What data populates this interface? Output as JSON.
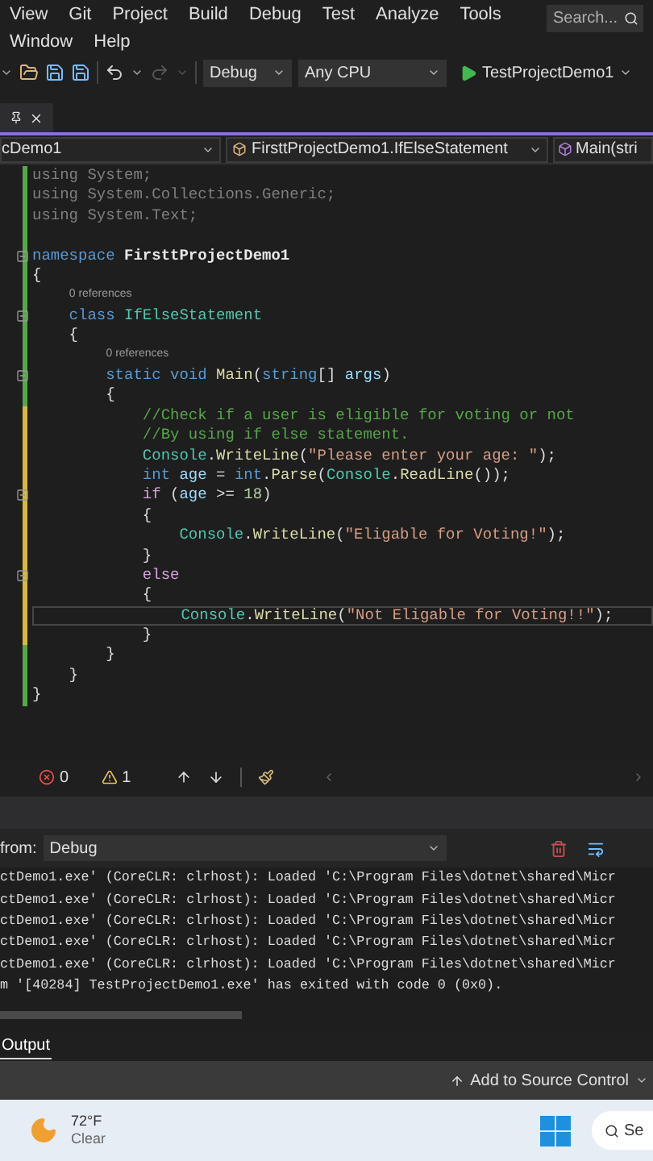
{
  "menu_rows": [
    [
      "View",
      "Git",
      "Project",
      "Build",
      "Debug",
      "Test",
      "Analyze",
      "Tools"
    ],
    [
      "Window",
      "Help"
    ]
  ],
  "search": {
    "placeholder": "Search..."
  },
  "toolbar": {
    "undo": {
      "disabled": false
    },
    "redo": {
      "disabled": true
    },
    "configuration": "Debug",
    "platform": "Any CPU",
    "start_target": "TestProjectDemo1"
  },
  "nav_bar": {
    "project": "cDemo1",
    "type": "FirsttProjectDemo1.IfElseStatement",
    "member": "Main(stri"
  },
  "editor": {
    "lines": [
      {
        "modified": false,
        "fold": false,
        "current": false,
        "tokens": [
          {
            "kind": "dim",
            "text": "using System;"
          }
        ]
      },
      {
        "modified": false,
        "fold": false,
        "current": false,
        "tokens": [
          {
            "kind": "dim",
            "text": "using System.Collections.Generic;"
          }
        ]
      },
      {
        "modified": false,
        "fold": false,
        "current": false,
        "tokens": [
          {
            "kind": "dim",
            "text": "using System.Text;"
          }
        ]
      },
      {
        "modified": false,
        "fold": false,
        "current": false
      },
      {
        "modified": false,
        "fold": true,
        "current": false,
        "tokens": [
          {
            "kind": "keyword",
            "text": "namespace"
          },
          {
            "kind": "name",
            "text": " FirsttProjectDemo1"
          }
        ]
      },
      {
        "modified": false,
        "fold": false,
        "current": false,
        "tokens": [
          {
            "kind": "plain",
            "text": "{"
          }
        ]
      },
      {
        "modified": false,
        "fold": true,
        "current": false,
        "reference_count": "0 references",
        "tokens": [
          {
            "kind": "keyword",
            "text": "    class"
          },
          {
            "kind": "type",
            "text": " IfElseStatement"
          }
        ]
      },
      {
        "modified": false,
        "fold": false,
        "current": false,
        "tokens": [
          {
            "kind": "plain",
            "text": "    {"
          }
        ]
      },
      {
        "modified": false,
        "fold": true,
        "current": false,
        "reference_count": "0 references",
        "tokens": [
          {
            "kind": "keyword",
            "text": "        static void"
          },
          {
            "kind": "method",
            "text": " Main"
          },
          {
            "kind": "plain",
            "text": "("
          },
          {
            "kind": "keyword",
            "text": "string"
          },
          {
            "kind": "plain",
            "text": "[] "
          },
          {
            "kind": "param",
            "text": "args"
          },
          {
            "kind": "plain",
            "text": ")"
          }
        ]
      },
      {
        "modified": false,
        "fold": false,
        "current": false,
        "tokens": [
          {
            "kind": "plain",
            "text": "        {"
          }
        ]
      },
      {
        "modified": true,
        "fold": false,
        "current": false,
        "tokens": [
          {
            "kind": "comment",
            "text": "            //Check if a user is eligible for voting or not"
          }
        ]
      },
      {
        "modified": true,
        "fold": false,
        "current": false,
        "tokens": [
          {
            "kind": "comment",
            "text": "            //By using if else statement."
          }
        ]
      },
      {
        "modified": true,
        "fold": false,
        "current": false,
        "tokens": [
          {
            "kind": "type",
            "text": "            Console"
          },
          {
            "kind": "plain",
            "text": "."
          },
          {
            "kind": "method",
            "text": "WriteLine"
          },
          {
            "kind": "plain",
            "text": "("
          },
          {
            "kind": "string",
            "text": "\"Please enter your age: \""
          },
          {
            "kind": "plain",
            "text": ");"
          }
        ]
      },
      {
        "modified": true,
        "fold": false,
        "current": false,
        "tokens": [
          {
            "kind": "keyword",
            "text": "            int"
          },
          {
            "kind": "param",
            "text": " age"
          },
          {
            "kind": "plain",
            "text": " = "
          },
          {
            "kind": "keyword",
            "text": "int"
          },
          {
            "kind": "plain",
            "text": "."
          },
          {
            "kind": "method",
            "text": "Parse"
          },
          {
            "kind": "plain",
            "text": "("
          },
          {
            "kind": "type",
            "text": "Console"
          },
          {
            "kind": "plain",
            "text": "."
          },
          {
            "kind": "method",
            "text": "ReadLine"
          },
          {
            "kind": "plain",
            "text": "());"
          }
        ]
      },
      {
        "modified": true,
        "fold": true,
        "current": false,
        "tokens": [
          {
            "kind": "control",
            "text": "            if"
          },
          {
            "kind": "plain",
            "text": " ("
          },
          {
            "kind": "param",
            "text": "age"
          },
          {
            "kind": "plain",
            "text": " >= "
          },
          {
            "kind": "number",
            "text": "18"
          },
          {
            "kind": "plain",
            "text": ")"
          }
        ]
      },
      {
        "modified": true,
        "fold": false,
        "current": false,
        "tokens": [
          {
            "kind": "plain",
            "text": "            {"
          }
        ]
      },
      {
        "modified": true,
        "fold": false,
        "current": false,
        "tokens": [
          {
            "kind": "type",
            "text": "                Console"
          },
          {
            "kind": "plain",
            "text": "."
          },
          {
            "kind": "method",
            "text": "WriteLine"
          },
          {
            "kind": "plain",
            "text": "("
          },
          {
            "kind": "string",
            "text": "\"Eligable for Voting!\""
          },
          {
            "kind": "plain",
            "text": ");"
          }
        ]
      },
      {
        "modified": true,
        "fold": false,
        "current": false,
        "tokens": [
          {
            "kind": "plain",
            "text": "            }"
          }
        ]
      },
      {
        "modified": true,
        "fold": true,
        "current": false,
        "tokens": [
          {
            "kind": "control",
            "text": "            else"
          }
        ]
      },
      {
        "modified": true,
        "fold": false,
        "current": false,
        "tokens": [
          {
            "kind": "plain",
            "text": "            {"
          }
        ]
      },
      {
        "modified": true,
        "fold": false,
        "current": true,
        "tokens": [
          {
            "kind": "type",
            "text": "                Console"
          },
          {
            "kind": "plain",
            "text": "."
          },
          {
            "kind": "method",
            "text": "WriteLine"
          },
          {
            "kind": "plain",
            "text": "("
          },
          {
            "kind": "string",
            "text": "\"Not Eligable for Voting!!\""
          },
          {
            "kind": "plain",
            "text": ");"
          }
        ]
      },
      {
        "modified": true,
        "fold": false,
        "current": false,
        "tokens": [
          {
            "kind": "plain",
            "text": "            }"
          }
        ]
      },
      {
        "modified": false,
        "fold": false,
        "current": false,
        "tokens": [
          {
            "kind": "plain",
            "text": "        }"
          }
        ]
      },
      {
        "modified": false,
        "fold": false,
        "current": false,
        "tokens": [
          {
            "kind": "plain",
            "text": "    }"
          }
        ]
      },
      {
        "modified": false,
        "fold": false,
        "current": false,
        "tokens": [
          {
            "kind": "plain",
            "text": "}"
          }
        ]
      }
    ]
  },
  "error_bar": {
    "errors": "0",
    "warnings": "1"
  },
  "output": {
    "source_label": "from:",
    "source": "Debug",
    "lines": [
      "ctDemo1.exe' (CoreCLR: clrhost): Loaded 'C:\\Program Files\\dotnet\\shared\\Micr",
      "ctDemo1.exe' (CoreCLR: clrhost): Loaded 'C:\\Program Files\\dotnet\\shared\\Micr",
      "ctDemo1.exe' (CoreCLR: clrhost): Loaded 'C:\\Program Files\\dotnet\\shared\\Micr",
      "ctDemo1.exe' (CoreCLR: clrhost): Loaded 'C:\\Program Files\\dotnet\\shared\\Micr",
      "ctDemo1.exe' (CoreCLR: clrhost): Loaded 'C:\\Program Files\\dotnet\\shared\\Micr",
      "m '[40284] TestProjectDemo1.exe' has exited with code 0 (0x0)."
    ]
  },
  "bottom_tabs": [
    {
      "label": "Output",
      "selected": true
    }
  ],
  "status_bar": {
    "action": "Add to Source Control"
  },
  "taskbar": {
    "temperature": "72°F",
    "condition": "Clear",
    "search": "Se"
  }
}
